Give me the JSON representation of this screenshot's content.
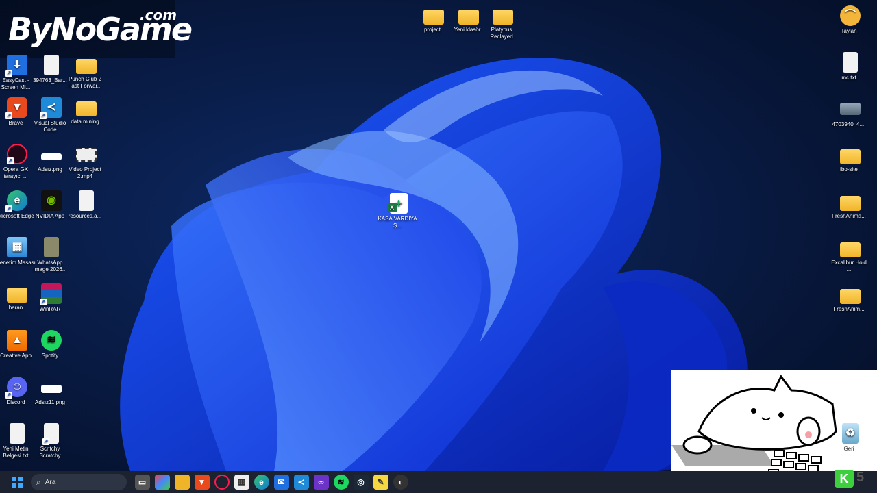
{
  "logo": {
    "main": "ByNoGame",
    "com": ".com"
  },
  "desktop": {
    "top_icons": [
      {
        "label": "project"
      },
      {
        "label": "Yeni klasör"
      },
      {
        "label": "Platypus Reclayed"
      }
    ],
    "left_icons": [
      {
        "label": "EasyCast - Screen Mi..."
      },
      {
        "label": "394763_Bar..."
      },
      {
        "label": "Punch Club 2 Fast Forwar..."
      },
      {
        "label": "Brave"
      },
      {
        "label": "Visual Studio Code"
      },
      {
        "label": "data mining"
      },
      {
        "label": "Opera GX tarayıcı ..."
      },
      {
        "label": "Adsız.png"
      },
      {
        "label": "Video Project 2.mp4"
      },
      {
        "label": "Microsoft Edge"
      },
      {
        "label": "NVIDIA App"
      },
      {
        "label": "resources.a..."
      },
      {
        "label": "Denetim Masası"
      },
      {
        "label": "WhatsApp Image 2026..."
      },
      {
        "label": "baran"
      },
      {
        "label": "WinRAR"
      },
      {
        "label": "Creative App"
      },
      {
        "label": "Spotify"
      },
      {
        "label": "Discord"
      },
      {
        "label": "Adsız11.png"
      },
      {
        "label": "Yeni Metin Belgesi.txt"
      },
      {
        "label": "Scritchy Scratchy"
      }
    ],
    "center_icon": {
      "label": "KASA VARDİYA Ş..."
    },
    "right_icons": [
      {
        "label": "Taylan"
      },
      {
        "label": "mc.txt"
      },
      {
        "label": "4703940_4...."
      },
      {
        "label": "ibo-site"
      },
      {
        "label": "FreshAnima..."
      },
      {
        "label": "Excalibur Hold ..."
      },
      {
        "label": "FreshAnim..."
      },
      {
        "label": "Geri"
      }
    ]
  },
  "taskbar": {
    "search_placeholder": "Ara",
    "counter_value": "5",
    "counter_badge": "K"
  }
}
